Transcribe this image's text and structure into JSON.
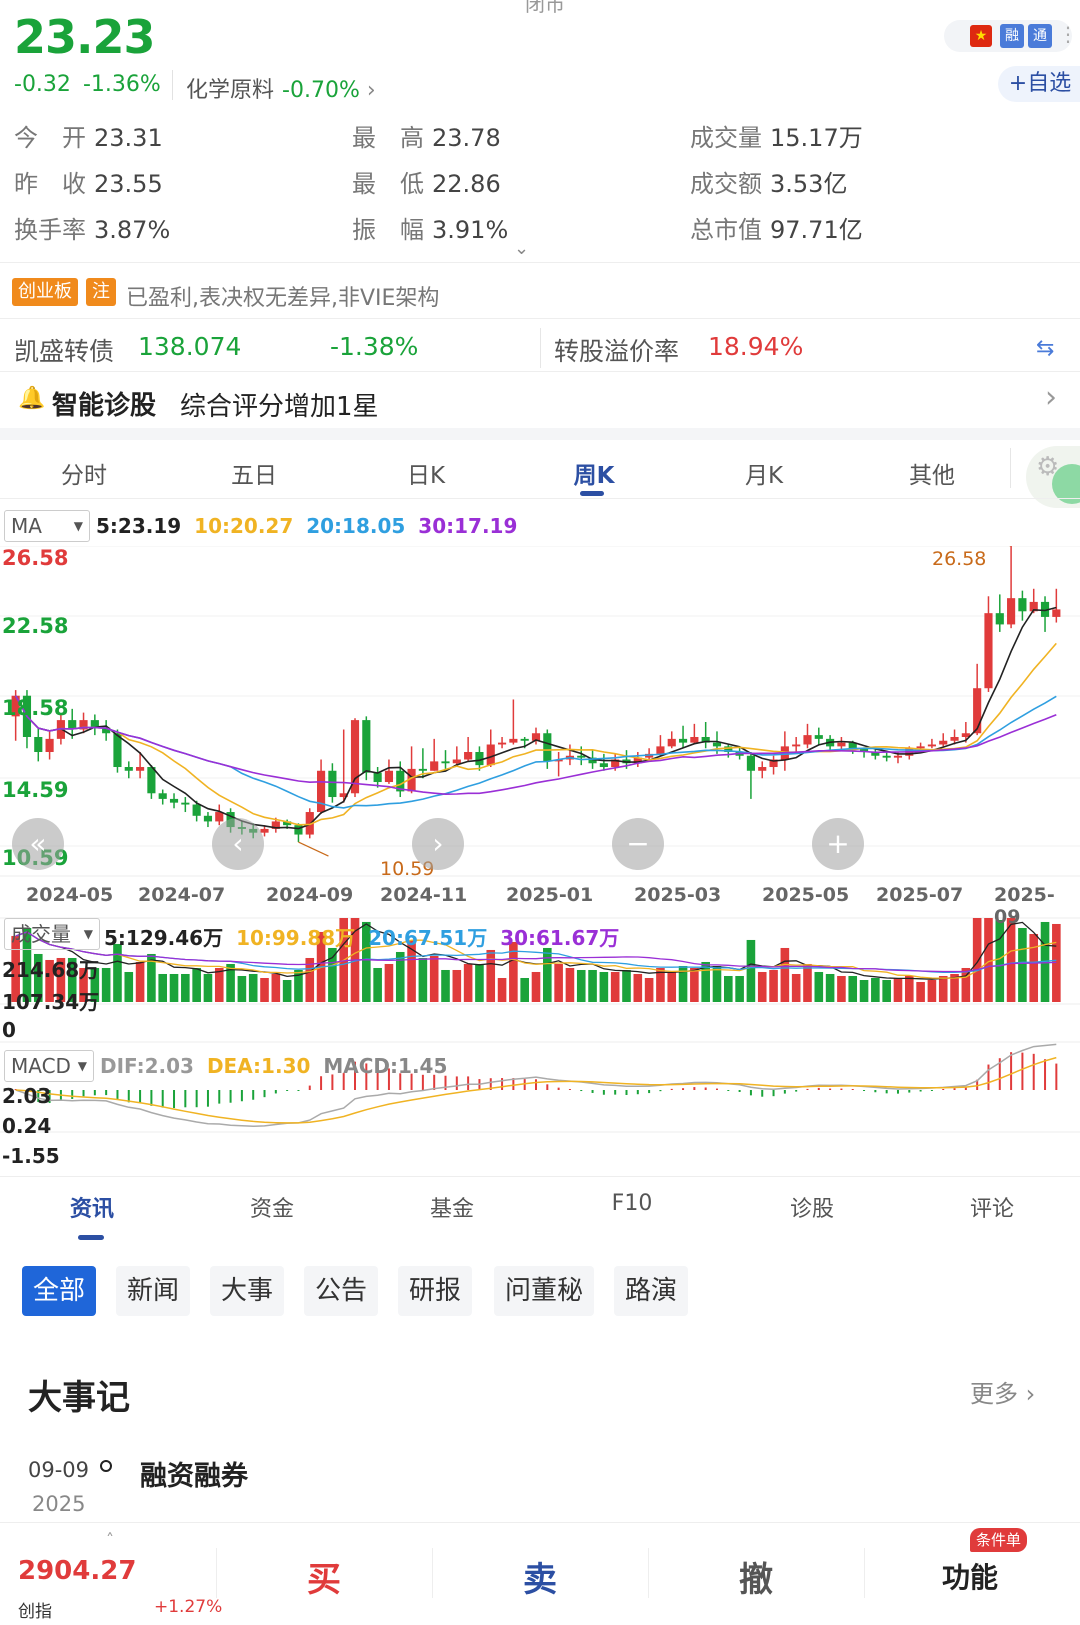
{
  "header": {
    "status_top": "闭市",
    "price": "23.23",
    "change": "-0.32",
    "change_pct": "-1.36%",
    "sector_name": "化学原料",
    "sector_pct": "-0.70%",
    "sector_arrow": "›",
    "flag_icon": "china-flag-icon",
    "tag_rong": "融",
    "tag_tong": "通",
    "more": "⋮",
    "add_fav": "+自选"
  },
  "stats": {
    "open_lbl": "今　开",
    "open": "23.31",
    "high_lbl": "最　高",
    "high": "23.78",
    "vol_lbl": "成交量",
    "vol": "15.17万",
    "prev_lbl": "昨　收",
    "prev": "23.55",
    "low_lbl": "最　低",
    "low": "22.86",
    "amt_lbl": "成交额",
    "amt": "3.53亿",
    "turn_lbl": "换手率",
    "turn": "3.87%",
    "amp_lbl": "振　幅",
    "amp": "3.91%",
    "cap_lbl": "总市值",
    "cap": "97.71亿",
    "expand": "⌄"
  },
  "tags": {
    "cyb": "创业板",
    "zhu": "注",
    "info": "已盈利,表决权无差异,非VIE架构"
  },
  "bond": {
    "name": "凯盛转债",
    "price": "138.074",
    "pct": "-1.38%",
    "premium_lbl": "转股溢价率",
    "premium": "18.94%",
    "swap_icon": "⇆"
  },
  "diag": {
    "bell": "🔔",
    "title": "智能诊股",
    "text": "综合评分增加1星",
    "chevron": "›"
  },
  "ktabs": [
    "分时",
    "五日",
    "日K",
    "周K",
    "月K",
    "其他"
  ],
  "ma": {
    "selector": "MA",
    "ma5": "5:23.19",
    "ma10": "10:20.27",
    "ma20": "20:18.05",
    "ma30": "30:17.19"
  },
  "vol_ind": {
    "selector": "成交量",
    "ma5": "5:129.46万",
    "ma10": "10:99.88万",
    "ma20": "20:67.51万",
    "ma30": "30:61.67万"
  },
  "macd_ind": {
    "selector": "MACD",
    "dif": "DIF:2.03",
    "dea": "DEA:1.30",
    "macd": "MACD:1.45"
  },
  "nav": {
    "back": "«",
    "prev": "‹",
    "next": "›",
    "zoom_out": "−",
    "zoom_in": "+"
  },
  "colors": {
    "up": "#e03b3b",
    "down": "#1aa33a",
    "ma5": "#222222",
    "ma10": "#f0b323",
    "ma20": "#2f9fe0",
    "ma30": "#9a2fd6",
    "accent": "#2c4fa3"
  },
  "chart_data": [
    {
      "type": "candlestick",
      "title": "周K",
      "price_labels": [
        "26.58",
        "22.58",
        "18.58",
        "14.59",
        "10.59"
      ],
      "ylim": [
        10.59,
        26.58
      ],
      "x_ticks": [
        "2024-05",
        "2024-07",
        "2024-09",
        "2024-11",
        "2025-01",
        "2025-03",
        "2025-05",
        "2025-07",
        "2025-09"
      ],
      "annotations": {
        "high": "26.58",
        "low": "10.59"
      },
      "candles": [
        [
          17.5,
          18.6,
          16.2,
          18.9
        ],
        [
          18.6,
          16.4,
          15.8,
          18.9
        ],
        [
          16.4,
          15.6,
          15.1,
          16.9
        ],
        [
          15.6,
          16.3,
          15.2,
          16.7
        ],
        [
          16.3,
          17.3,
          16.0,
          17.6
        ],
        [
          17.3,
          16.8,
          16.3,
          17.9
        ],
        [
          16.8,
          17.3,
          16.6,
          17.7
        ],
        [
          17.3,
          16.9,
          16.5,
          17.6
        ],
        [
          16.9,
          16.6,
          16.2,
          17.3
        ],
        [
          16.6,
          14.8,
          14.5,
          16.8
        ],
        [
          14.8,
          14.6,
          14.2,
          15.1
        ],
        [
          14.6,
          14.8,
          14.2,
          15.6
        ],
        [
          14.8,
          13.4,
          13.1,
          14.9
        ],
        [
          13.4,
          13.1,
          12.8,
          13.6
        ],
        [
          13.1,
          12.9,
          12.6,
          13.4
        ],
        [
          12.9,
          12.8,
          12.4,
          13.2
        ],
        [
          12.8,
          12.2,
          11.9,
          13.0
        ],
        [
          12.2,
          11.9,
          11.6,
          12.4
        ],
        [
          11.9,
          12.4,
          11.7,
          12.8
        ],
        [
          12.4,
          11.6,
          11.3,
          12.6
        ],
        [
          11.6,
          11.5,
          11.2,
          11.9
        ],
        [
          11.5,
          11.3,
          11.0,
          11.8
        ],
        [
          11.3,
          11.5,
          11.1,
          11.7
        ],
        [
          11.5,
          11.9,
          11.3,
          12.1
        ],
        [
          11.9,
          11.7,
          11.5,
          12.0
        ],
        [
          11.7,
          11.2,
          10.8,
          11.8
        ],
        [
          11.2,
          12.4,
          11.0,
          12.6
        ],
        [
          12.4,
          14.6,
          12.3,
          15.2
        ],
        [
          14.6,
          13.2,
          12.9,
          15.0
        ],
        [
          13.2,
          13.4,
          12.9,
          16.8
        ],
        [
          13.4,
          17.3,
          13.2,
          17.4
        ],
        [
          17.3,
          14.5,
          14.1,
          17.5
        ],
        [
          14.5,
          14.0,
          13.7,
          14.8
        ],
        [
          14.0,
          14.6,
          13.9,
          15.2
        ],
        [
          14.6,
          13.5,
          13.2,
          15.1
        ],
        [
          13.5,
          14.7,
          13.4,
          15.9
        ],
        [
          14.7,
          14.6,
          14.2,
          15.8
        ],
        [
          14.6,
          15.1,
          14.6,
          16.3
        ],
        [
          15.1,
          15.0,
          14.7,
          15.7
        ],
        [
          15.0,
          15.2,
          14.9,
          15.9
        ],
        [
          15.2,
          15.6,
          15.1,
          16.4
        ],
        [
          15.6,
          14.9,
          14.6,
          15.9
        ],
        [
          14.9,
          16.0,
          14.8,
          16.8
        ],
        [
          16.0,
          16.1,
          15.8,
          16.4
        ],
        [
          16.1,
          16.3,
          16.0,
          18.4
        ],
        [
          16.3,
          16.2,
          15.8,
          16.4
        ],
        [
          16.2,
          16.6,
          16.0,
          16.9
        ],
        [
          16.6,
          15.1,
          14.7,
          16.8
        ],
        [
          15.1,
          15.2,
          14.3,
          15.6
        ],
        [
          15.2,
          15.4,
          14.9,
          16.0
        ],
        [
          15.4,
          15.3,
          14.9,
          15.9
        ],
        [
          15.3,
          15.0,
          14.7,
          15.7
        ],
        [
          15.0,
          14.8,
          14.6,
          15.5
        ],
        [
          14.8,
          15.2,
          14.6,
          15.5
        ],
        [
          15.2,
          15.0,
          14.7,
          15.7
        ],
        [
          15.0,
          15.3,
          14.8,
          15.6
        ],
        [
          15.3,
          15.5,
          15.2,
          15.8
        ],
        [
          15.5,
          15.9,
          15.4,
          16.5
        ],
        [
          15.9,
          16.3,
          15.8,
          16.7
        ],
        [
          16.3,
          16.1,
          15.8,
          17.0
        ],
        [
          16.1,
          16.4,
          16.0,
          17.1
        ],
        [
          16.4,
          16.1,
          15.8,
          17.2
        ],
        [
          16.1,
          15.9,
          15.5,
          16.7
        ],
        [
          15.9,
          15.6,
          15.3,
          16.0
        ],
        [
          15.6,
          15.4,
          15.2,
          15.9
        ],
        [
          15.4,
          14.6,
          13.1,
          15.6
        ],
        [
          14.6,
          14.8,
          14.2,
          15.1
        ],
        [
          14.8,
          15.2,
          14.4,
          15.4
        ],
        [
          15.2,
          15.9,
          14.6,
          16.7
        ],
        [
          15.9,
          16.0,
          15.6,
          16.4
        ],
        [
          16.0,
          16.5,
          15.8,
          17.1
        ],
        [
          16.5,
          16.3,
          16.0,
          16.9
        ],
        [
          16.3,
          15.9,
          15.7,
          16.5
        ],
        [
          15.9,
          16.1,
          15.7,
          16.4
        ],
        [
          16.1,
          15.8,
          15.5,
          16.2
        ],
        [
          15.8,
          15.6,
          15.3,
          15.8
        ],
        [
          15.6,
          15.4,
          15.2,
          15.8
        ],
        [
          15.4,
          15.3,
          15.1,
          15.6
        ],
        [
          15.3,
          15.4,
          15.0,
          15.6
        ],
        [
          15.4,
          15.8,
          15.2,
          15.9
        ],
        [
          15.8,
          15.9,
          15.7,
          16.1
        ],
        [
          15.9,
          16.0,
          15.8,
          16.3
        ],
        [
          16.0,
          16.2,
          15.9,
          16.6
        ],
        [
          16.2,
          16.4,
          16.0,
          16.8
        ],
        [
          16.4,
          16.6,
          16.1,
          17.2
        ],
        [
          16.6,
          19.0,
          16.5,
          20.3
        ],
        [
          19.0,
          23.0,
          18.8,
          23.9
        ],
        [
          23.0,
          22.4,
          22.0,
          24.0
        ],
        [
          22.4,
          23.8,
          22.2,
          26.58
        ],
        [
          23.8,
          23.1,
          22.6,
          24.2
        ],
        [
          23.1,
          23.6,
          23.0,
          24.3
        ],
        [
          23.6,
          22.8,
          22.0,
          23.9
        ],
        [
          22.8,
          23.2,
          22.5,
          24.3
        ]
      ]
    },
    {
      "type": "bar",
      "title": "成交量",
      "y_labels": [
        "214.68万",
        "107.34万",
        "0"
      ],
      "ylim": [
        0,
        214.68
      ]
    },
    {
      "type": "bar",
      "title": "MACD",
      "y_labels": [
        "2.03",
        "0.24",
        "-1.55"
      ],
      "ylim": [
        -1.55,
        2.03
      ]
    }
  ],
  "content_tabs": [
    "资讯",
    "资金",
    "基金",
    "F10",
    "诊股",
    "评论"
  ],
  "chips": [
    "全部",
    "新闻",
    "大事",
    "公告",
    "研报",
    "问董秘",
    "路演"
  ],
  "events": {
    "title": "大事记",
    "more": "更多 ›",
    "date": "09-09",
    "year": "2025",
    "item": "融资融券"
  },
  "bottom": {
    "index_value": "2904.27",
    "index_name": "创指",
    "index_pct": "+1.27%",
    "up_arrow": "˄",
    "buy": "买",
    "sell": "卖",
    "cancel": "撤",
    "func": "功能",
    "cond": "条件单"
  }
}
